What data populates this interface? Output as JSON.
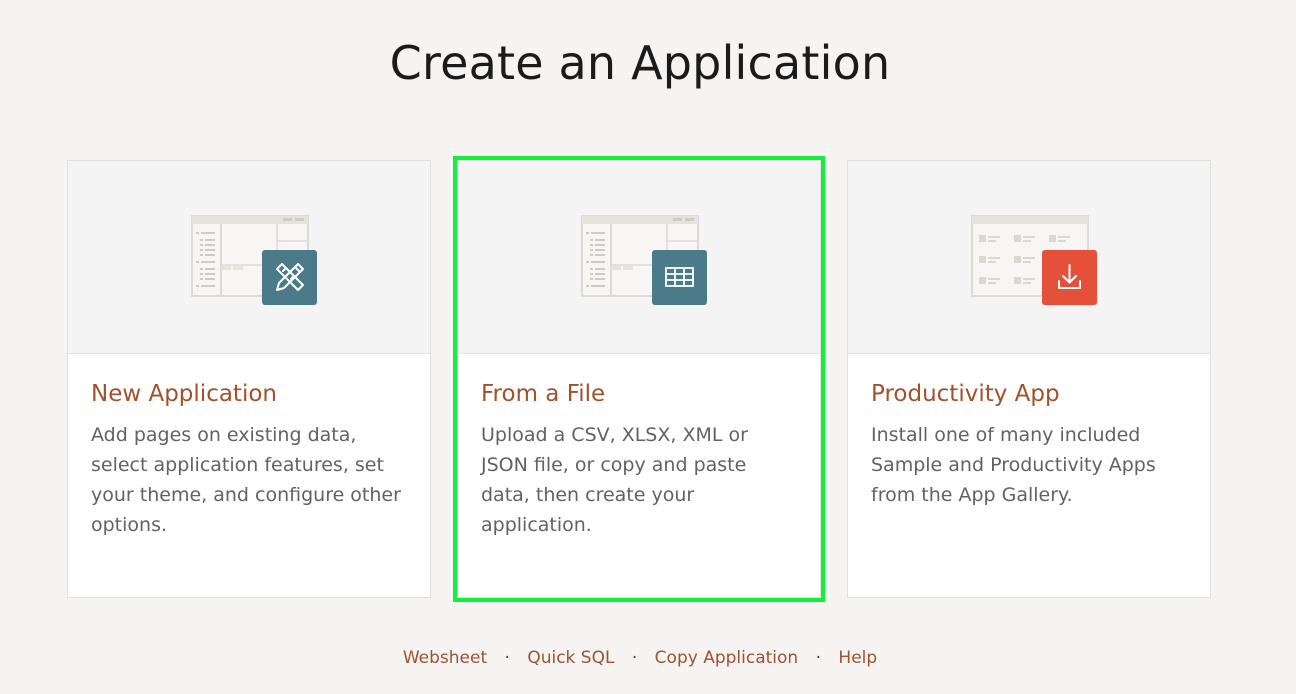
{
  "title": "Create an Application",
  "cards": [
    {
      "title": "New Application",
      "description": "Add pages on existing data, select application features, set your theme, and configure other options.",
      "icon": "pencil-ruler-icon",
      "icon_color": "#4b7b88"
    },
    {
      "title": "From a File",
      "description": "Upload a CSV, XLSX, XML or JSON file, or copy and paste data, then create your application.",
      "icon": "table-grid-icon",
      "icon_color": "#4b7b88",
      "selected": true
    },
    {
      "title": "Productivity App",
      "description": "Install one of many included Sample and Productivity Apps from the App Gallery.",
      "icon": "download-icon",
      "icon_color": "#e4503a"
    }
  ],
  "footer_links": [
    {
      "label": "Websheet"
    },
    {
      "label": "Quick SQL"
    },
    {
      "label": "Copy Application"
    },
    {
      "label": "Help"
    }
  ],
  "footer_separator": "·",
  "colors": {
    "accent_text": "#a0522d",
    "selection_outline": "#14ef3c",
    "background": "#f5f4f2"
  }
}
